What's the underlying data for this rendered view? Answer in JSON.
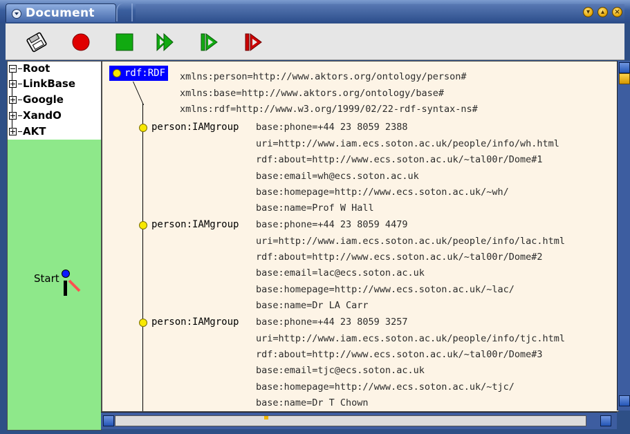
{
  "window": {
    "title": "Document",
    "buttons": [
      "minimize-icon",
      "maximize-icon",
      "close-icon"
    ]
  },
  "toolbar": {
    "tools": [
      {
        "name": "save-disk-icon"
      },
      {
        "name": "record-icon",
        "color": "#e00000"
      },
      {
        "name": "stop-icon",
        "color": "#11aa11"
      },
      {
        "name": "fast-forward-icon",
        "color": "#11aa11"
      },
      {
        "name": "step-forward-icon",
        "color": "#11aa11"
      },
      {
        "name": "step-forward-red-icon",
        "color": "#cc0000"
      }
    ]
  },
  "tree": {
    "root": "Root",
    "children": [
      "LinkBase",
      "Google",
      "XandO",
      "AKT"
    ]
  },
  "sidebar": {
    "start_label": "Start"
  },
  "document": {
    "root_label": "rdf:RDF",
    "root_attrs": [
      "xmlns:person=http://www.aktors.org/ontology/person#",
      "xmlns:base=http://www.aktors.org/ontology/base#",
      "xmlns:rdf=http://www.w3.org/1999/02/22-rdf-syntax-ns#"
    ],
    "nodes": [
      {
        "label": "person:IAMgroup",
        "attrs": [
          "base:phone=+44 23 8059 2388",
          "uri=http://www.iam.ecs.soton.ac.uk/people/info/wh.html",
          "rdf:about=http://www.ecs.soton.ac.uk/~tal00r/Dome#1",
          "base:email=wh@ecs.soton.ac.uk",
          "base:homepage=http://www.ecs.soton.ac.uk/~wh/",
          "base:name=Prof W Hall"
        ]
      },
      {
        "label": "person:IAMgroup",
        "attrs": [
          "base:phone=+44 23 8059 4479",
          "uri=http://www.iam.ecs.soton.ac.uk/people/info/lac.html",
          "rdf:about=http://www.ecs.soton.ac.uk/~tal00r/Dome#2",
          "base:email=lac@ecs.soton.ac.uk",
          "base:homepage=http://www.ecs.soton.ac.uk/~lac/",
          "base:name=Dr LA Carr"
        ]
      },
      {
        "label": "person:IAMgroup",
        "attrs": [
          "base:phone=+44 23 8059 3257",
          "uri=http://www.iam.ecs.soton.ac.uk/people/info/tjc.html",
          "rdf:about=http://www.ecs.soton.ac.uk/~tal00r/Dome#3",
          "base:email=tjc@ecs.soton.ac.uk",
          "base:homepage=http://www.ecs.soton.ac.uk/~tjc/",
          "base:name=Dr T Chown"
        ]
      }
    ]
  },
  "colors": {
    "selection": "#0000ff",
    "bullet": "#f8e800",
    "doc_background": "#fdf4e6",
    "sidebar_background": "#8ee88a"
  }
}
